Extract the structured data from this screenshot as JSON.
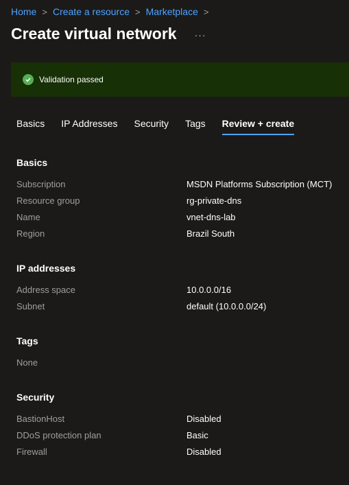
{
  "breadcrumb": [
    "Home",
    "Create a resource",
    "Marketplace"
  ],
  "page_title": "Create virtual network",
  "more_label": "···",
  "banner": {
    "text": "Validation passed",
    "color": "#173006"
  },
  "tabs": [
    {
      "label": "Basics",
      "active": false
    },
    {
      "label": "IP Addresses",
      "active": false
    },
    {
      "label": "Security",
      "active": false
    },
    {
      "label": "Tags",
      "active": false
    },
    {
      "label": "Review + create",
      "active": true
    }
  ],
  "basics": {
    "title": "Basics",
    "rows": [
      {
        "label": "Subscription",
        "value": "MSDN Platforms Subscription (MCT)"
      },
      {
        "label": "Resource group",
        "value": "rg-private-dns"
      },
      {
        "label": "Name",
        "value": "vnet-dns-lab"
      },
      {
        "label": "Region",
        "value": "Brazil South"
      }
    ]
  },
  "ip": {
    "title": "IP addresses",
    "rows": [
      {
        "label": "Address space",
        "value": "10.0.0.0/16"
      },
      {
        "label": "Subnet",
        "value": "default (10.0.0.0/24)"
      }
    ]
  },
  "tags": {
    "title": "Tags",
    "none_text": "None"
  },
  "security": {
    "title": "Security",
    "rows": [
      {
        "label": "BastionHost",
        "value": "Disabled"
      },
      {
        "label": "DDoS protection plan",
        "value": "Basic"
      },
      {
        "label": "Firewall",
        "value": "Disabled"
      }
    ]
  },
  "colors": {
    "accent": "#4da3ff",
    "background": "#1b1a19",
    "success": "#54b054"
  }
}
